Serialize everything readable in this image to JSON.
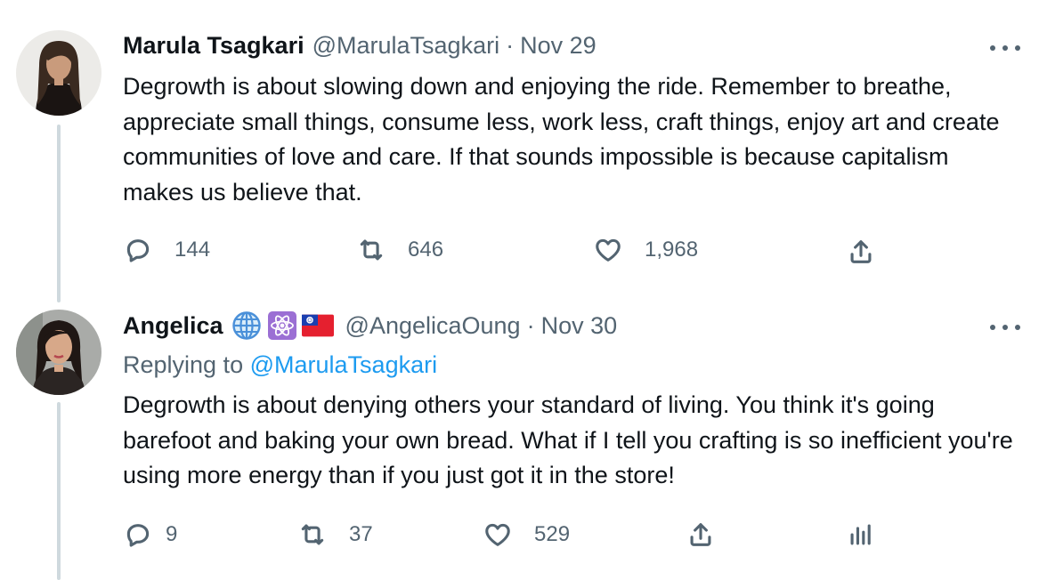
{
  "tweets": [
    {
      "name": "Marula Tsagkari",
      "handle": "@MarulaTsagkari",
      "separator": "·",
      "date": "Nov 29",
      "text": "Degrowth is about slowing down and enjoying the ride. Remember to breathe, appreciate small things, consume less, work less,  craft things, enjoy art and create communities of love and care. If that sounds impossible is because capitalism makes us believe that.",
      "replies": "144",
      "retweets": "646",
      "likes": "1,968"
    },
    {
      "name": "Angelica",
      "badges": [
        "globe-icon",
        "atom-icon",
        "taiwan-flag-icon"
      ],
      "handle": "@AngelicaOung",
      "separator": "·",
      "date": "Nov 30",
      "replying_prefix": "Replying to",
      "replying_to": "@MarulaTsagkari",
      "text": "Degrowth is about denying others your standard of living. You think it's going barefoot and baking your own bread. What if I tell you crafting is so inefficient you're using more energy than if you just got it in the store!",
      "replies": "9",
      "retweets": "37",
      "likes": "529"
    }
  ],
  "colors": {
    "text": "#0f1419",
    "secondary": "#536471",
    "accent": "#1d9bf0",
    "thread_line": "#cfd9de"
  }
}
